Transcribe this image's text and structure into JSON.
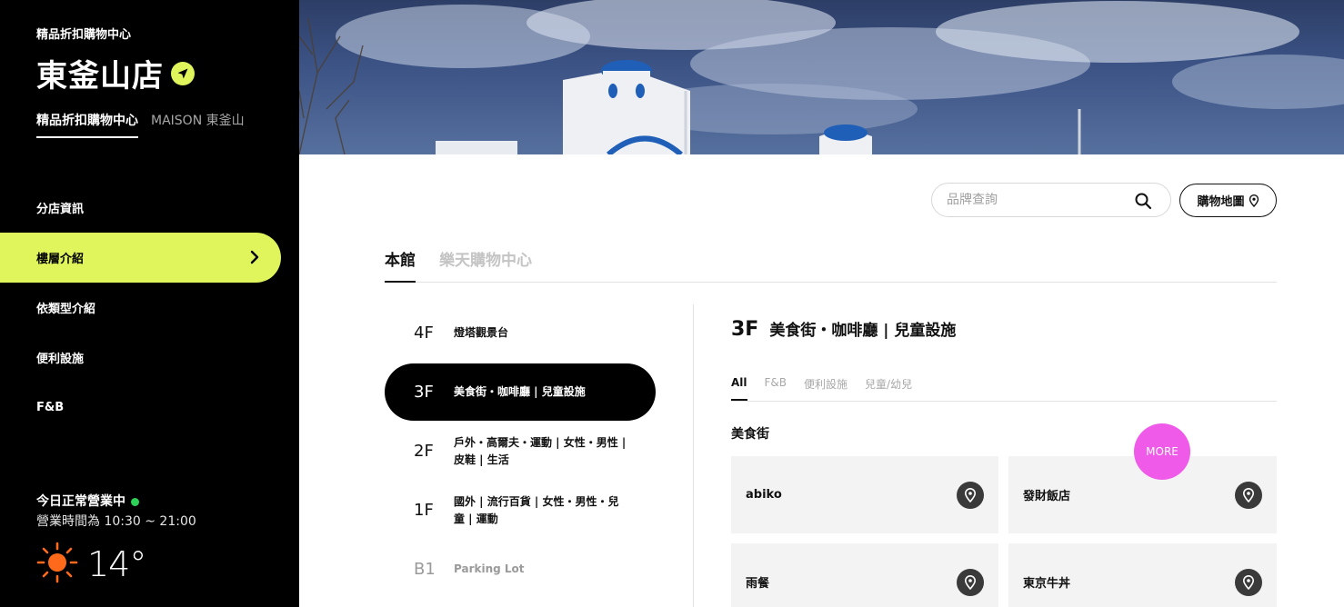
{
  "sidebar": {
    "brand_subtitle": "精品折扣購物中心",
    "store_name": "東釜山店",
    "store_tabs": [
      {
        "label": "精品折扣購物中心",
        "active": true
      },
      {
        "label": "MAISON 東釜山",
        "active": false
      }
    ],
    "menu": [
      {
        "label": "分店資訊",
        "active": false
      },
      {
        "label": "樓層介紹",
        "active": true
      },
      {
        "label": "依類型介紹",
        "active": false
      },
      {
        "label": "便利設施",
        "active": false
      },
      {
        "label": "F&B",
        "active": false
      }
    ],
    "status_text": "今日正常營業中",
    "hours_text": "營業時間為 10:30 ~ 21:00",
    "temperature": "14°"
  },
  "toolbar": {
    "search_placeholder": "品牌查詢",
    "map_button": "購物地圖"
  },
  "building_tabs": [
    {
      "label": "本館",
      "active": true
    },
    {
      "label": "樂天購物中心",
      "active": false
    }
  ],
  "floors": [
    {
      "level": "4F",
      "desc": "燈塔觀景台",
      "state": "normal"
    },
    {
      "level": "3F",
      "desc": "美食街・咖啡廳 | 兒童設施",
      "state": "active"
    },
    {
      "level": "2F",
      "desc": "戶外・高爾夫・運動 | 女性・男性 | 皮鞋 | 生活",
      "state": "normal"
    },
    {
      "level": "1F",
      "desc": "國外 | 流行百貨 | 女性・男性・兒童 | 運動",
      "state": "normal"
    },
    {
      "level": "B1",
      "desc": "Parking Lot",
      "state": "muted"
    }
  ],
  "detail": {
    "level": "3F",
    "desc": "美食街・咖啡廳 | 兒童設施",
    "filters": [
      {
        "label": "All",
        "active": true
      },
      {
        "label": "F&B",
        "active": false
      },
      {
        "label": "便利設施",
        "active": false
      },
      {
        "label": "兒童/幼兒",
        "active": false
      }
    ],
    "section_title": "美食街",
    "stores": [
      "abiko",
      "發財飯店",
      "雨餐",
      "東京牛丼"
    ],
    "more_label": "MORE"
  },
  "colors": {
    "accent_lime": "#e0f55b",
    "open_green": "#2ed158",
    "more_pink": "#ef5ae8"
  }
}
